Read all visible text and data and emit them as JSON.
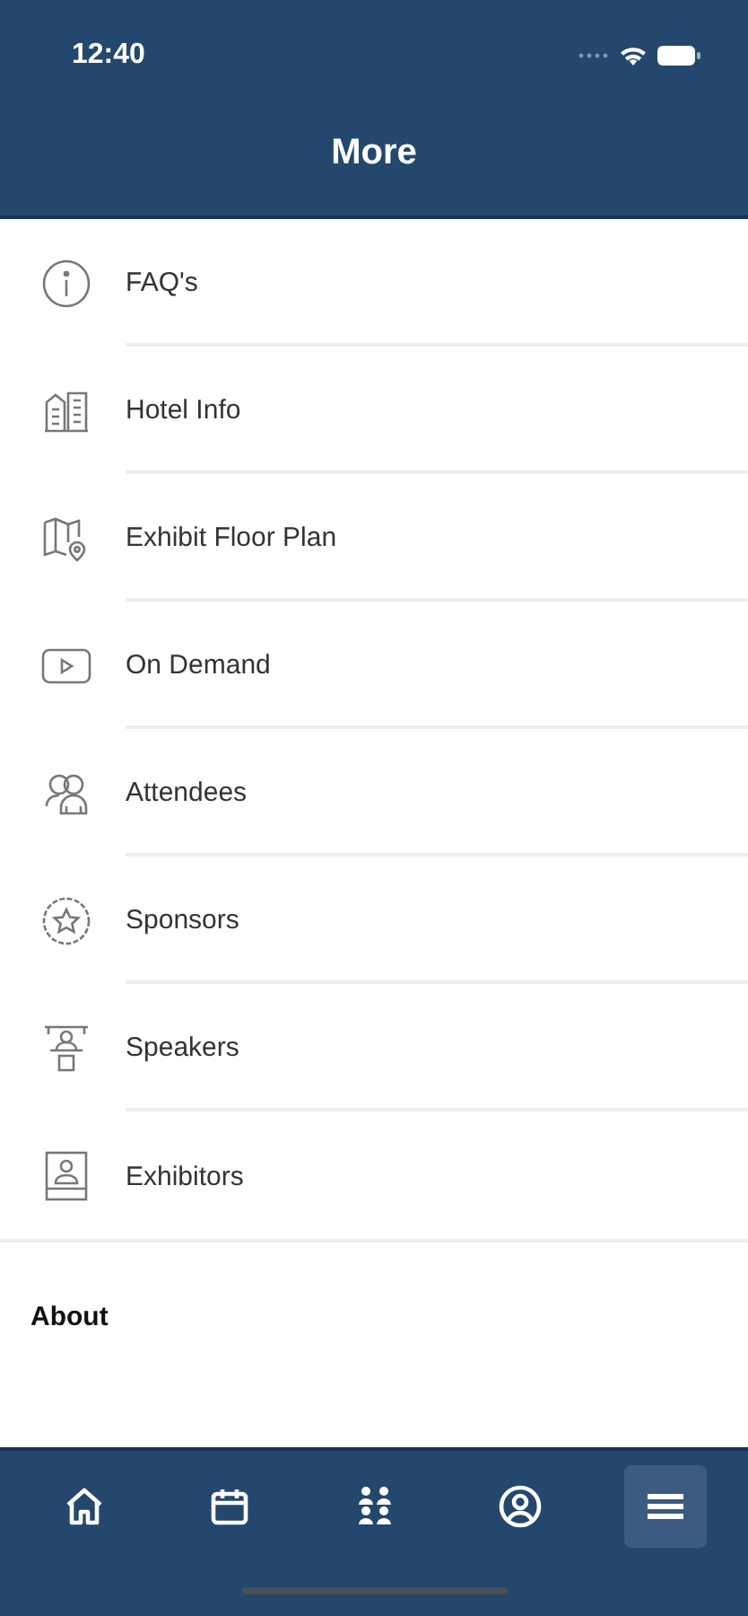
{
  "status_bar": {
    "time": "12:40"
  },
  "header": {
    "title": "More"
  },
  "menu_items": [
    {
      "kind": "info",
      "label": "FAQ's"
    },
    {
      "kind": "hotel",
      "label": "Hotel Info"
    },
    {
      "kind": "map",
      "label": "Exhibit Floor Plan"
    },
    {
      "kind": "video",
      "label": "On Demand"
    },
    {
      "kind": "people",
      "label": "Attendees"
    },
    {
      "kind": "star",
      "label": "Sponsors"
    },
    {
      "kind": "speaker",
      "label": "Speakers"
    },
    {
      "kind": "booth",
      "label": "Exhibitors"
    }
  ],
  "section": {
    "title": "About"
  },
  "tab_bar": [
    {
      "kind": "home",
      "selected": false
    },
    {
      "kind": "calendar",
      "selected": false
    },
    {
      "kind": "group",
      "selected": false
    },
    {
      "kind": "profile",
      "selected": false
    },
    {
      "kind": "menu",
      "selected": true
    }
  ]
}
